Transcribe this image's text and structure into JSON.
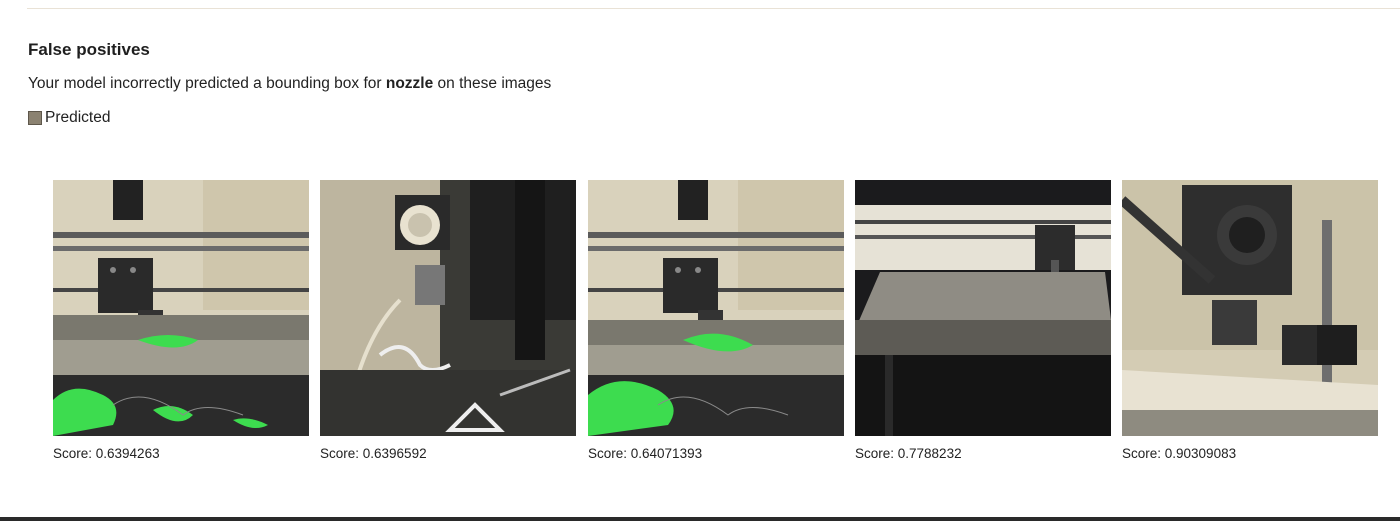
{
  "section": {
    "title": "False positives",
    "description_prefix": "Your model incorrectly predicted a bounding box for ",
    "label": "nozzle",
    "description_suffix": " on these images"
  },
  "legend": {
    "label": "Predicted",
    "color": "#8b8271"
  },
  "results": [
    {
      "score_text": "Score: 0.6394263"
    },
    {
      "score_text": "Score: 0.6396592"
    },
    {
      "score_text": "Score: 0.64071393"
    },
    {
      "score_text": "Score: 0.7788232"
    },
    {
      "score_text": "Score: 0.90309083"
    }
  ]
}
